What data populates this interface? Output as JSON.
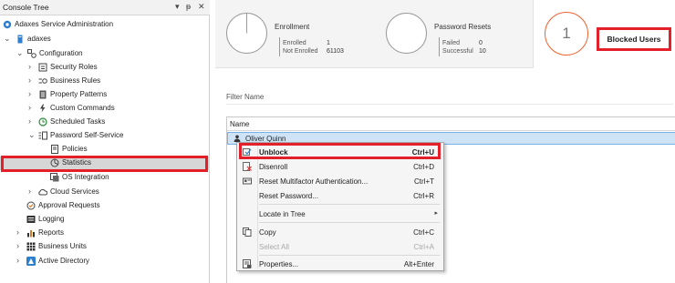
{
  "console_tree": {
    "title": "Console Tree",
    "controls": {
      "dropdown": "▾",
      "pin": "ᵽ",
      "close": "✕"
    },
    "items": [
      {
        "label": "Adaxes Service Administration",
        "icon": "service-admin-icon"
      },
      {
        "label": "adaxes",
        "icon": "server-icon"
      },
      {
        "label": "Configuration",
        "icon": "configuration-icon"
      },
      {
        "label": "Security Roles",
        "icon": "security-roles-icon"
      },
      {
        "label": "Business Rules",
        "icon": "business-rules-icon"
      },
      {
        "label": "Property Patterns",
        "icon": "property-patterns-icon"
      },
      {
        "label": "Custom Commands",
        "icon": "custom-commands-icon"
      },
      {
        "label": "Scheduled Tasks",
        "icon": "scheduled-tasks-icon"
      },
      {
        "label": "Password Self-Service",
        "icon": "password-self-service-icon"
      },
      {
        "label": "Policies",
        "icon": "policies-icon"
      },
      {
        "label": "Statistics",
        "icon": "statistics-icon"
      },
      {
        "label": "OS Integration",
        "icon": "os-integration-icon"
      },
      {
        "label": "Cloud Services",
        "icon": "cloud-services-icon"
      },
      {
        "label": "Approval Requests",
        "icon": "approval-requests-icon"
      },
      {
        "label": "Logging",
        "icon": "logging-icon"
      },
      {
        "label": "Reports",
        "icon": "reports-icon"
      },
      {
        "label": "Business Units",
        "icon": "business-units-icon"
      },
      {
        "label": "Active Directory",
        "icon": "active-directory-icon"
      }
    ]
  },
  "summary": {
    "enrollment": {
      "title": "Enrollment",
      "rows": [
        {
          "label": "Enrolled",
          "value": "1"
        },
        {
          "label": "Not Enrolled",
          "value": "61103"
        }
      ]
    },
    "password_resets": {
      "title": "Password Resets",
      "rows": [
        {
          "label": "Failed",
          "value": "0"
        },
        {
          "label": "Successful",
          "value": "10"
        }
      ]
    },
    "blocked_users": {
      "count": "1",
      "label": "Blocked Users"
    }
  },
  "filter": {
    "placeholder": "Filter Name"
  },
  "grid": {
    "columns": [
      "Name"
    ],
    "rows": [
      {
        "name": "Oliver Quinn",
        "icon": "user-icon"
      }
    ]
  },
  "context_menu": {
    "items": [
      {
        "label": "Unblock",
        "shortcut": "Ctrl+U",
        "icon": "unblock-icon"
      },
      {
        "label": "Disenroll",
        "shortcut": "Ctrl+D",
        "icon": "disenroll-icon"
      },
      {
        "label": "Reset Multifactor Authentication...",
        "shortcut": "Ctrl+T",
        "icon": "reset-mfa-icon"
      },
      {
        "label": "Reset Password...",
        "shortcut": "Ctrl+R"
      },
      {
        "label": "Locate in Tree",
        "submenu_arrow": "▸"
      },
      {
        "label": "Copy",
        "shortcut": "Ctrl+C",
        "icon": "copy-icon"
      },
      {
        "label": "Select All",
        "shortcut": "Ctrl+A"
      },
      {
        "label": "Properties...",
        "shortcut": "Alt+Enter",
        "icon": "properties-icon"
      }
    ]
  },
  "colors": {
    "highlight_red": "#e3202a",
    "selection_blue": "#cfe3f7",
    "blocked_accent": "#f0612d",
    "tree_selected": "#d6d6d6"
  }
}
